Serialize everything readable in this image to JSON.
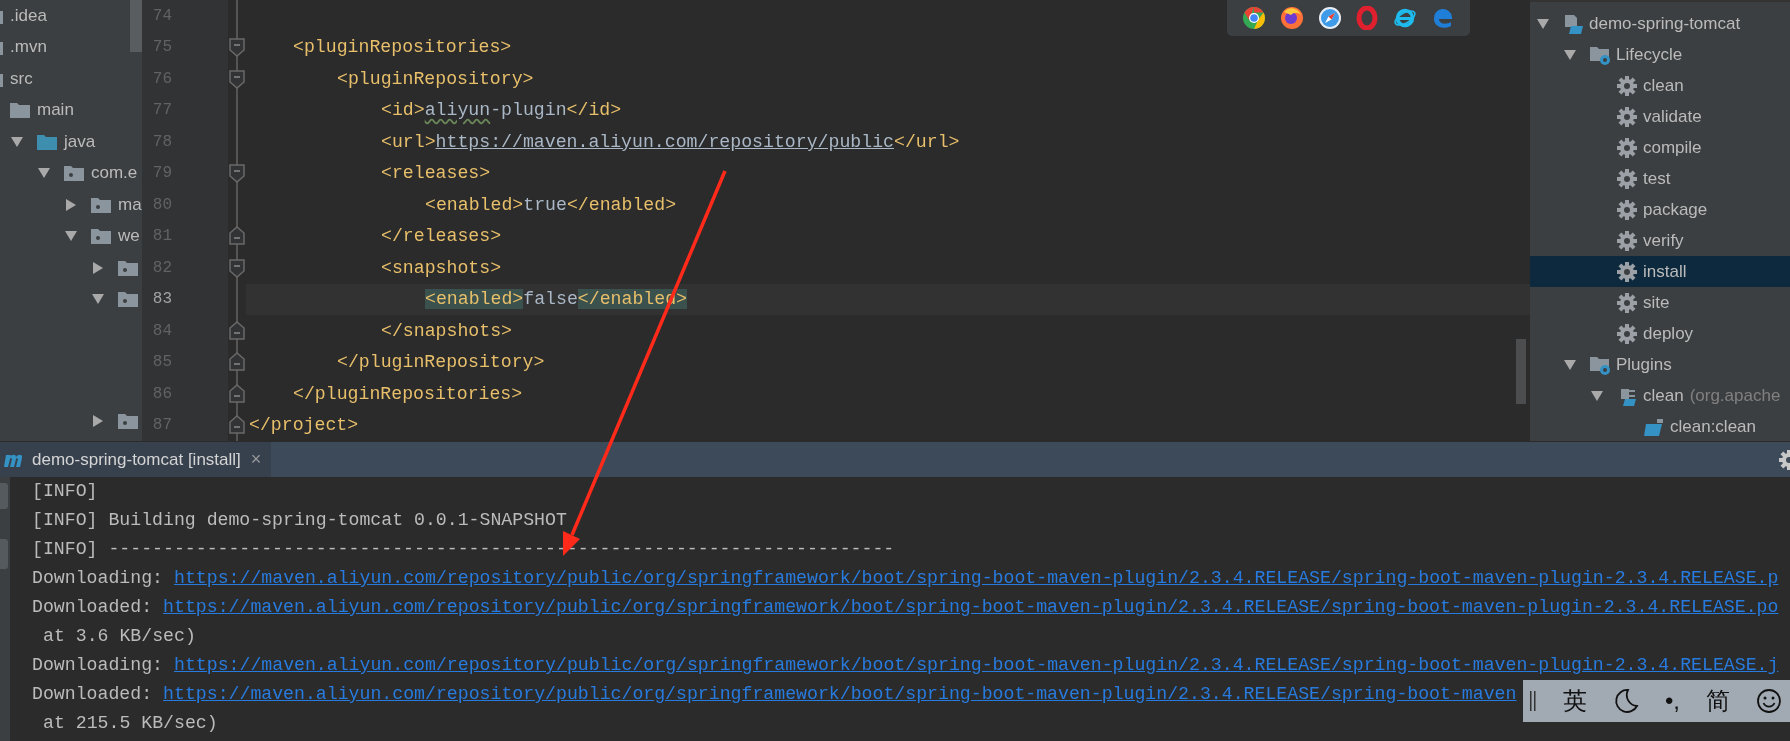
{
  "project_tree": {
    "items": [
      {
        "label": ".idea",
        "kind": "dir"
      },
      {
        "label": ".mvn",
        "kind": "dir"
      },
      {
        "label": "src",
        "kind": "dir",
        "children": [
          {
            "label": "main",
            "kind": "dir",
            "children": [
              {
                "label": "java",
                "kind": "source",
                "expanded": true,
                "children": [
                  {
                    "label": "com.e",
                    "kind": "package",
                    "expanded": true,
                    "children": [
                      {
                        "label": "ma",
                        "kind": "package",
                        "expanded": false
                      },
                      {
                        "label": "we",
                        "kind": "package",
                        "expanded": true,
                        "children": [
                          {
                            "kind": "package",
                            "expanded": false
                          },
                          {
                            "kind": "package",
                            "expanded": true
                          },
                          {
                            "kind": "package",
                            "expanded": false
                          }
                        ]
                      }
                    ]
                  }
                ]
              }
            ]
          }
        ]
      }
    ]
  },
  "browser_bar": {
    "browsers": [
      {
        "kind": "chrome"
      },
      {
        "kind": "firefox"
      },
      {
        "kind": "safari"
      },
      {
        "kind": "opera"
      },
      {
        "kind": "ie"
      },
      {
        "kind": "edge"
      }
    ]
  },
  "editor": {
    "lines": [
      {
        "number": "74",
        "current": false,
        "kind": "indent0",
        "fold_start": false,
        "fold_end": false
      },
      {
        "number": "75",
        "current": false,
        "kind": "indent1",
        "fold_start": true,
        "fold_end": false,
        "tokens": [
          {
            "kind": "tag",
            "text": "<pluginRepositories>"
          }
        ]
      },
      {
        "number": "76",
        "current": false,
        "kind": "indent2",
        "fold_start": true,
        "fold_end": false,
        "tokens": [
          {
            "kind": "tag",
            "text": "<pluginRepository>"
          }
        ]
      },
      {
        "number": "77",
        "current": false,
        "kind": "indent3",
        "fold_start": false,
        "fold_end": false,
        "tokens": [
          {
            "kind": "tag",
            "text": "<id>"
          },
          {
            "kind": "typo",
            "text": "aliyun"
          },
          {
            "kind": "value",
            "text": "-plugin"
          },
          {
            "kind": "tag",
            "text": "</id>"
          }
        ]
      },
      {
        "number": "78",
        "current": false,
        "kind": "indent3",
        "fold_start": false,
        "fold_end": false,
        "tokens": [
          {
            "kind": "tag",
            "text": "<url>"
          },
          {
            "kind": "link",
            "text": "https://maven.aliyun.com/repository/public"
          },
          {
            "kind": "tag",
            "text": "</url>"
          }
        ]
      },
      {
        "number": "79",
        "current": false,
        "kind": "indent3",
        "fold_start": true,
        "fold_end": false,
        "tokens": [
          {
            "kind": "tag",
            "text": "<releases>"
          }
        ]
      },
      {
        "number": "80",
        "current": false,
        "kind": "indent4",
        "fold_start": false,
        "fold_end": false,
        "tokens": [
          {
            "kind": "tag",
            "text": "<enabled>"
          },
          {
            "kind": "value",
            "text": "true"
          },
          {
            "kind": "tag",
            "text": "</enabled>"
          }
        ]
      },
      {
        "number": "81",
        "current": false,
        "kind": "indent3",
        "fold_start": false,
        "fold_end": true,
        "tokens": [
          {
            "kind": "tag",
            "text": "</releases>"
          }
        ]
      },
      {
        "number": "82",
        "current": false,
        "kind": "indent3",
        "fold_start": true,
        "fold_end": false,
        "tokens": [
          {
            "kind": "tag",
            "text": "<snapshots>"
          }
        ]
      },
      {
        "number": "83",
        "current": true,
        "kind": "indent4",
        "fold_start": false,
        "fold_end": false,
        "tokens": [
          {
            "kind": "tag-match",
            "text": "<enabled>"
          },
          {
            "kind": "value",
            "text": "false"
          },
          {
            "kind": "tag-match",
            "text": "</enabled>"
          }
        ]
      },
      {
        "number": "84",
        "current": false,
        "kind": "indent3",
        "fold_start": false,
        "fold_end": true,
        "tokens": [
          {
            "kind": "tag",
            "text": "</snapshots>"
          }
        ]
      },
      {
        "number": "85",
        "current": false,
        "kind": "indent2",
        "fold_start": false,
        "fold_end": true,
        "tokens": [
          {
            "kind": "tag",
            "text": "</pluginRepository>"
          }
        ]
      },
      {
        "number": "86",
        "current": false,
        "kind": "indent1",
        "fold_start": false,
        "fold_end": true,
        "tokens": [
          {
            "kind": "tag",
            "text": "</pluginRepositories>"
          }
        ]
      },
      {
        "number": "87",
        "current": false,
        "kind": "indent0",
        "fold_start": false,
        "fold_end": true,
        "tokens": [
          {
            "kind": "tag",
            "text": "</project>"
          }
        ]
      }
    ]
  },
  "maven": {
    "items": [
      {
        "label": "demo-spring-tomcat",
        "kind": "project",
        "expanded": true,
        "selected": false,
        "children": [
          {
            "label": "Lifecycle",
            "kind": "folder",
            "expanded": true,
            "selected": false,
            "children": [
              {
                "label": "clean",
                "kind": "goal",
                "selected": false
              },
              {
                "label": "validate",
                "kind": "goal",
                "selected": false
              },
              {
                "label": "compile",
                "kind": "goal",
                "selected": false
              },
              {
                "label": "test",
                "kind": "goal",
                "selected": false
              },
              {
                "label": "package",
                "kind": "goal",
                "selected": false
              },
              {
                "label": "verify",
                "kind": "goal",
                "selected": false
              },
              {
                "label": "install",
                "kind": "goal",
                "selected": true
              },
              {
                "label": "site",
                "kind": "goal",
                "selected": false
              },
              {
                "label": "deploy",
                "kind": "goal",
                "selected": false
              }
            ]
          },
          {
            "label": "Plugins",
            "kind": "folder",
            "expanded": true,
            "selected": false,
            "children": [
              {
                "label": "clean",
                "detail": "(org.apache",
                "kind": "plugin",
                "expanded": true,
                "selected": false,
                "children": [
                  {
                    "label": "clean:clean",
                    "kind": "plugin-goal",
                    "selected": false
                  }
                ]
              }
            ]
          }
        ]
      }
    ]
  },
  "run_panel": {
    "tab": {
      "title": "demo-spring-tomcat [install]",
      "close": "×",
      "selected": true
    },
    "lines": [
      {
        "kind": "info",
        "text": "[INFO]"
      },
      {
        "kind": "info",
        "text": "[INFO] Building demo-spring-tomcat 0.0.1-SNAPSHOT"
      },
      {
        "kind": "info",
        "text": "[INFO] ------------------------------------------------------------------------"
      },
      {
        "kind": "download",
        "prefix": "Downloading:",
        "url": "https://maven.aliyun.com/repository/public/org/springframework/boot/spring-boot-maven-plugin/2.3.4.RELEASE/spring-boot-maven-plugin-2.3.4.RELEASE.p"
      },
      {
        "kind": "download",
        "prefix": "Downloaded:",
        "url": "https://maven.aliyun.com/repository/public/org/springframework/boot/spring-boot-maven-plugin/2.3.4.RELEASE/spring-boot-maven-plugin-2.3.4.RELEASE.po"
      },
      {
        "kind": "cont",
        "text": "at 3.6 KB/sec)"
      },
      {
        "kind": "download",
        "prefix": "Downloading:",
        "url": "https://maven.aliyun.com/repository/public/org/springframework/boot/spring-boot-maven-plugin/2.3.4.RELEASE/spring-boot-maven-plugin-2.3.4.RELEASE.j"
      },
      {
        "kind": "download",
        "prefix": "Downloaded:",
        "url": "https://maven.aliyun.com/repository/public/org/springframework/boot/spring-boot-maven-plugin/2.3.4.RELEASE/spring-boot-maven"
      },
      {
        "kind": "cont",
        "text": "at 215.5 KB/sec)"
      }
    ]
  },
  "input_method_bar": {
    "items": [
      {
        "kind": "text",
        "text": "英"
      },
      {
        "kind": "moon"
      },
      {
        "kind": "text",
        "text": "•,"
      },
      {
        "kind": "text",
        "text": "简"
      },
      {
        "kind": "smile"
      }
    ]
  }
}
